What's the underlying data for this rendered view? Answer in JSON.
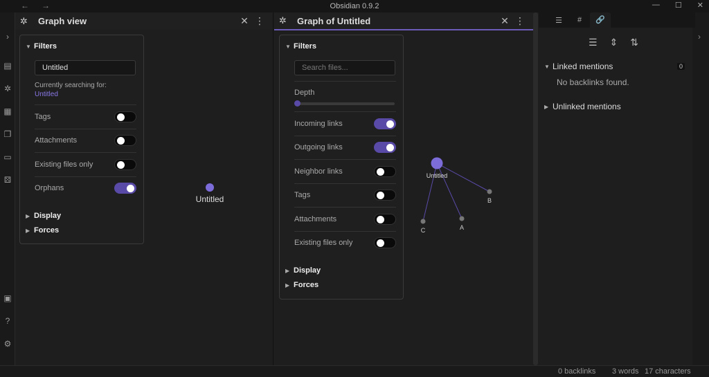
{
  "window": {
    "title": "Obsidian 0.9.2"
  },
  "left_pane": {
    "title": "Graph view",
    "filters": {
      "label": "Filters",
      "search_value": "Untitled",
      "search_note": "Currently searching for:",
      "search_term": "Untitled",
      "toggles": [
        {
          "label": "Tags",
          "on": false
        },
        {
          "label": "Attachments",
          "on": false
        },
        {
          "label": "Existing files only",
          "on": false
        },
        {
          "label": "Orphans",
          "on": true
        }
      ],
      "display": "Display",
      "forces": "Forces"
    },
    "graph": {
      "node_label": "Untitled"
    }
  },
  "mid_pane": {
    "title": "Graph of Untitled",
    "filters": {
      "label": "Filters",
      "search_placeholder": "Search files...",
      "depth_label": "Depth",
      "depth_fraction": 0.0,
      "toggles": [
        {
          "label": "Incoming links",
          "on": true
        },
        {
          "label": "Outgoing links",
          "on": true
        },
        {
          "label": "Neighbor links",
          "on": false
        },
        {
          "label": "Tags",
          "on": false
        },
        {
          "label": "Attachments",
          "on": false
        },
        {
          "label": "Existing files only",
          "on": false
        }
      ],
      "display": "Display",
      "forces": "Forces"
    },
    "graph": {
      "center": "Untitled",
      "nodes": [
        "B",
        "A",
        "C"
      ]
    }
  },
  "right_pane": {
    "linked_mentions": "Linked mentions",
    "linked_count": "0",
    "no_backlinks": "No backlinks found.",
    "unlinked_mentions": "Unlinked mentions"
  },
  "status": {
    "backlinks": "0 backlinks",
    "words": "3 words",
    "characters": "17 characters"
  },
  "colors": {
    "accent": "#7b6cd9",
    "toggle_on": "#5a4aa8"
  }
}
